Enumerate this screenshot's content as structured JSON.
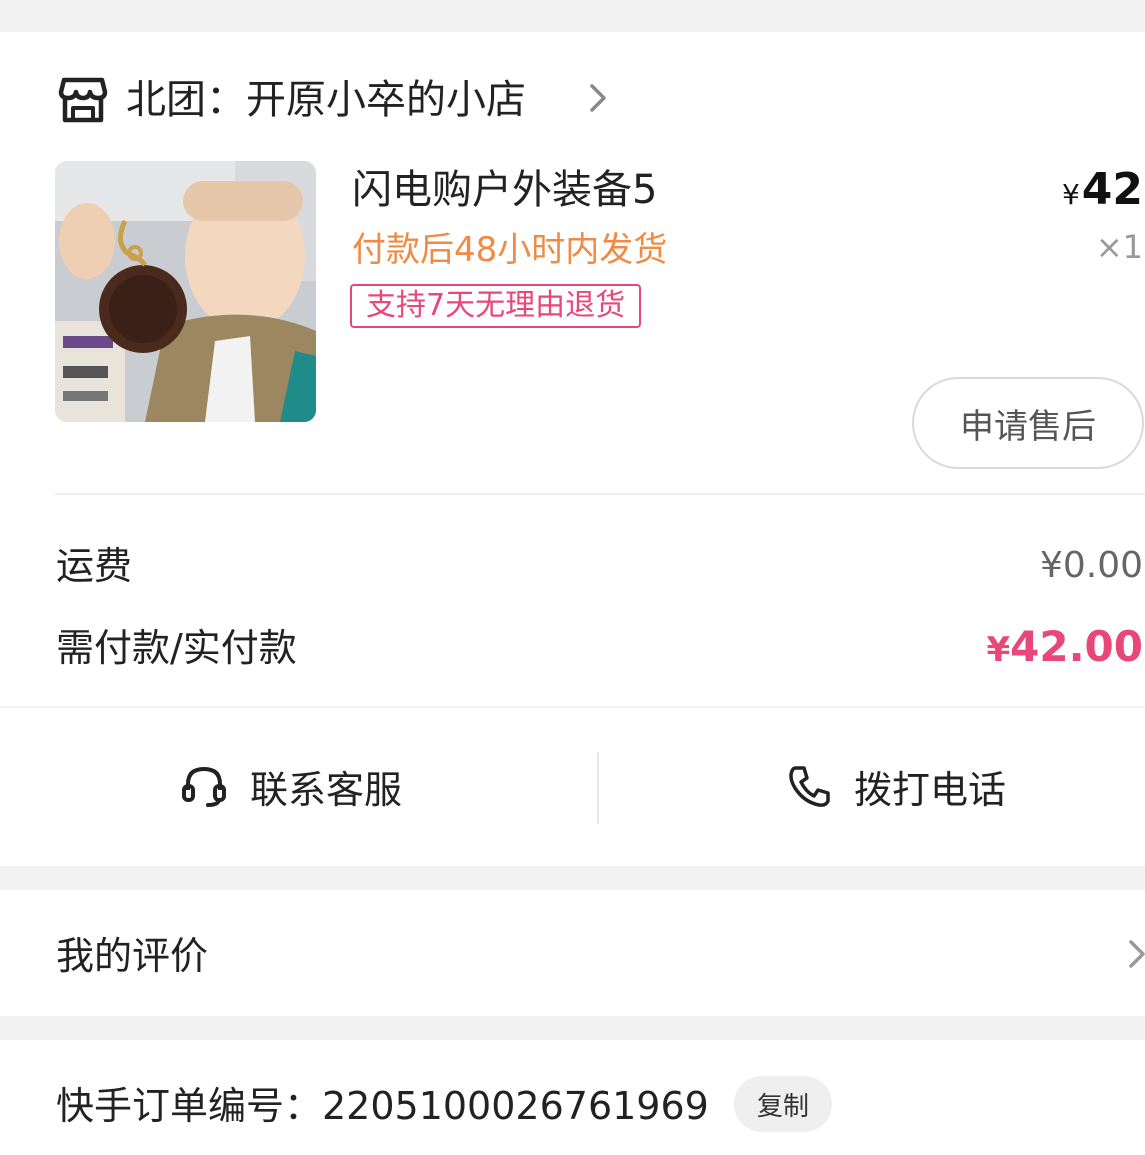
{
  "shop": {
    "name": "北团：开原小卒的小店"
  },
  "product": {
    "title": "闪电购户外装备5",
    "shipping_note": "付款后48小时内发货",
    "return_tag": "支持7天无理由退货",
    "currency_symbol": "¥",
    "price": "42",
    "quantity": "×1",
    "after_sale_label": "申请售后"
  },
  "fees": {
    "shipping_label": "运费",
    "shipping_value": "¥0.00",
    "total_label": "需付款/实付款",
    "total_currency": "¥",
    "total_value": "42.00"
  },
  "contact": {
    "service_label": "联系客服",
    "phone_label": "拨打电话"
  },
  "review": {
    "label": "我的评价"
  },
  "order": {
    "number_label": "快手订单编号：2205100026761969",
    "copy_label": "复制"
  },
  "colors": {
    "accent_pink": "#e8477a",
    "shipping_orange": "#f08a44",
    "page_background": "#f2f2f2"
  }
}
